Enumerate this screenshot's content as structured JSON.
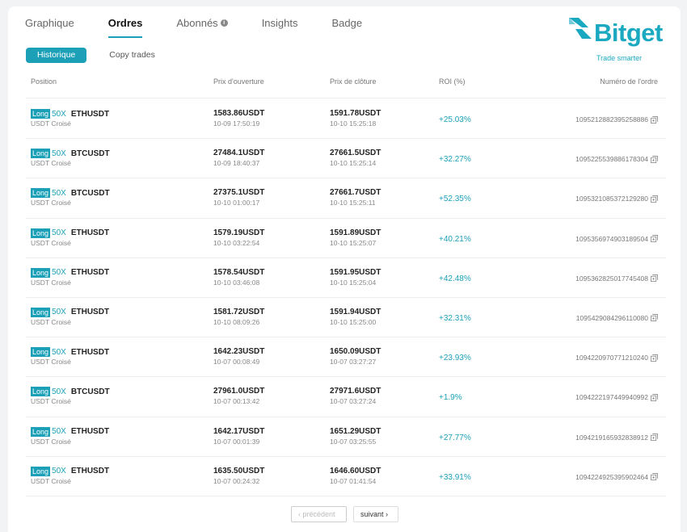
{
  "tabs": [
    {
      "label": "Graphique"
    },
    {
      "label": "Ordres"
    },
    {
      "label": "Abonnés"
    },
    {
      "label": "Insights"
    },
    {
      "label": "Badge"
    }
  ],
  "active_tab": "Ordres",
  "brand": {
    "name": "Bitget",
    "tagline": "Trade smarter",
    "color": "#1ba9c2"
  },
  "accent_color": "#1ca0b8",
  "subtabs": {
    "history": "Historique",
    "copy": "Copy trades"
  },
  "table": {
    "headers": {
      "position": "Position",
      "open_price": "Prix d'ouverture",
      "close_price": "Prix de clôture",
      "roi": "ROI (%)",
      "order_no": "Numéro de l'ordre"
    },
    "rows": [
      {
        "side": "Long",
        "lev": "50X",
        "pair": "ETHUSDT",
        "margin": "USDT Croisé",
        "open": "1583.86USDT",
        "open_time": "10-09 17:50:19",
        "close": "1591.78USDT",
        "close_time": "10-10 15:25:18",
        "roi": "+25.03%",
        "order": "1095212882395258886"
      },
      {
        "side": "Long",
        "lev": "50X",
        "pair": "BTCUSDT",
        "margin": "USDT Croisé",
        "open": "27484.1USDT",
        "open_time": "10-09 18:40:37",
        "close": "27661.5USDT",
        "close_time": "10-10 15:25:14",
        "roi": "+32.27%",
        "order": "1095225539886178304"
      },
      {
        "side": "Long",
        "lev": "50X",
        "pair": "BTCUSDT",
        "margin": "USDT Croisé",
        "open": "27375.1USDT",
        "open_time": "10-10 01:00:17",
        "close": "27661.7USDT",
        "close_time": "10-10 15:25:11",
        "roi": "+52.35%",
        "order": "1095321085372129280"
      },
      {
        "side": "Long",
        "lev": "50X",
        "pair": "ETHUSDT",
        "margin": "USDT Croisé",
        "open": "1579.19USDT",
        "open_time": "10-10 03:22:54",
        "close": "1591.89USDT",
        "close_time": "10-10 15:25:07",
        "roi": "+40.21%",
        "order": "1095356974903189504"
      },
      {
        "side": "Long",
        "lev": "50X",
        "pair": "ETHUSDT",
        "margin": "USDT Croisé",
        "open": "1578.54USDT",
        "open_time": "10-10 03:46:08",
        "close": "1591.95USDT",
        "close_time": "10-10 15:25:04",
        "roi": "+42.48%",
        "order": "1095362825017745408"
      },
      {
        "side": "Long",
        "lev": "50X",
        "pair": "ETHUSDT",
        "margin": "USDT Croisé",
        "open": "1581.72USDT",
        "open_time": "10-10 08:09:26",
        "close": "1591.94USDT",
        "close_time": "10-10 15:25:00",
        "roi": "+32.31%",
        "order": "1095429084296110080"
      },
      {
        "side": "Long",
        "lev": "50X",
        "pair": "ETHUSDT",
        "margin": "USDT Croisé",
        "open": "1642.23USDT",
        "open_time": "10-07 00:08:49",
        "close": "1650.09USDT",
        "close_time": "10-07 03:27:27",
        "roi": "+23.93%",
        "order": "1094220970771210240"
      },
      {
        "side": "Long",
        "lev": "50X",
        "pair": "BTCUSDT",
        "margin": "USDT Croisé",
        "open": "27961.0USDT",
        "open_time": "10-07 00:13:42",
        "close": "27971.6USDT",
        "close_time": "10-07 03:27:24",
        "roi": "+1.9%",
        "order": "1094222197449940992"
      },
      {
        "side": "Long",
        "lev": "50X",
        "pair": "ETHUSDT",
        "margin": "USDT Croisé",
        "open": "1642.17USDT",
        "open_time": "10-07 00:01:39",
        "close": "1651.29USDT",
        "close_time": "10-07 03:25:55",
        "roi": "+27.77%",
        "order": "1094219165932838912"
      },
      {
        "side": "Long",
        "lev": "50X",
        "pair": "ETHUSDT",
        "margin": "USDT Croisé",
        "open": "1635.50USDT",
        "open_time": "10-07 00:24:32",
        "close": "1646.60USDT",
        "close_time": "10-07 01:41:54",
        "roi": "+33.91%",
        "order": "1094224925395902464"
      }
    ]
  },
  "pager": {
    "prev": "‹ précédent",
    "next": "suivant ›"
  }
}
